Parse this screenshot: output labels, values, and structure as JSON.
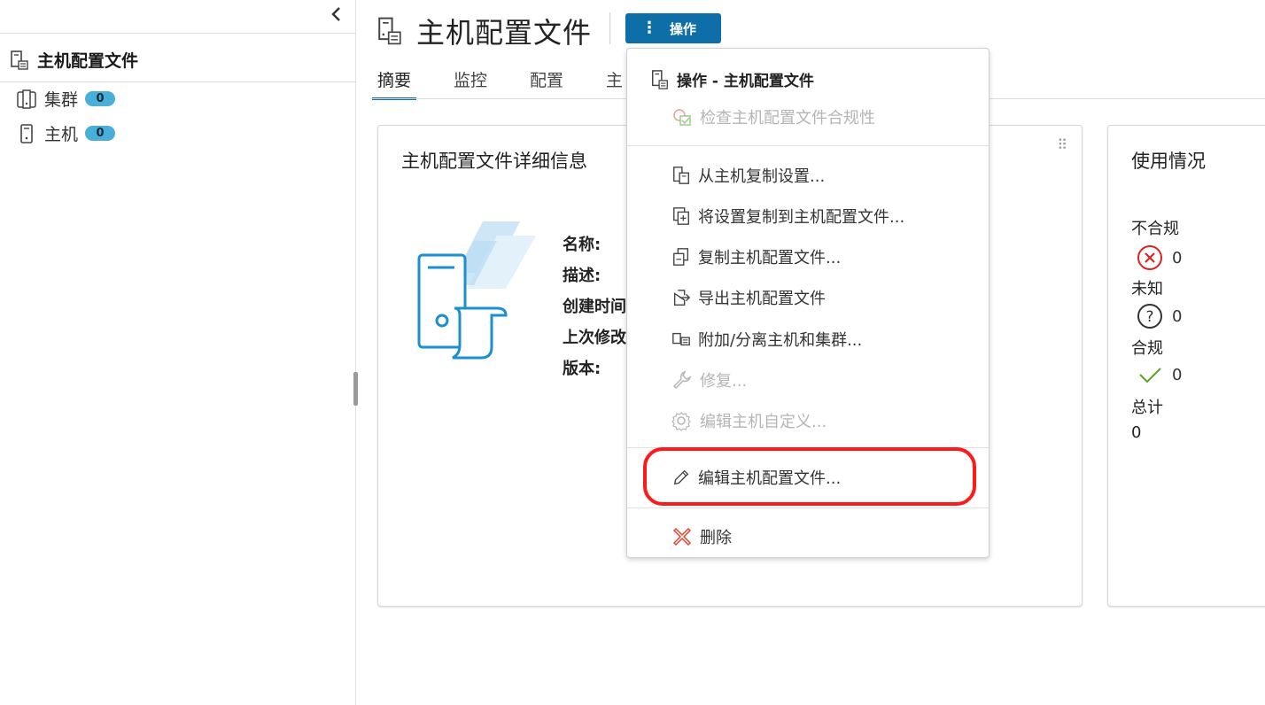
{
  "navigator": {
    "collapse_icon": "chevron-left",
    "root_label": "主机配置文件",
    "items": [
      {
        "label": "集群",
        "count": "0",
        "icon": "cluster-icon"
      },
      {
        "label": "主机",
        "count": "0",
        "icon": "host-icon"
      }
    ]
  },
  "header": {
    "title": "主机配置文件",
    "actions_label": "操作"
  },
  "tabs": [
    {
      "label": "摘要",
      "active": true
    },
    {
      "label": "监控",
      "active": false
    },
    {
      "label": "配置",
      "active": false
    },
    {
      "label": "主",
      "active": false
    }
  ],
  "details_card": {
    "title": "主机配置文件详细信息",
    "fields": [
      "名称:",
      "描述:",
      "创建时间",
      "上次修改",
      "版本:"
    ]
  },
  "usage_card": {
    "title": "使用情况",
    "rows": [
      {
        "label": "不合规",
        "value": "0",
        "icon": "error-circle-icon",
        "color": "#e02020"
      },
      {
        "label": "未知",
        "value": "0",
        "icon": "question-circle-icon",
        "color": "#333333"
      },
      {
        "label": "合规",
        "value": "0",
        "icon": "check-icon",
        "color": "#5aa220"
      },
      {
        "label": "总计",
        "value": "0"
      }
    ]
  },
  "actions_menu": {
    "header": "操作 - 主机配置文件",
    "items": [
      {
        "label": "检查主机配置文件合规性",
        "enabled": false,
        "icon": "check-compliance-icon"
      },
      {
        "label": "从主机复制设置...",
        "enabled": true,
        "icon": "copy-from-host-icon"
      },
      {
        "label": "将设置复制到主机配置文件...",
        "enabled": true,
        "icon": "copy-to-profile-icon"
      },
      {
        "label": "复制主机配置文件...",
        "enabled": true,
        "icon": "duplicate-icon"
      },
      {
        "label": "导出主机配置文件",
        "enabled": true,
        "icon": "export-icon"
      },
      {
        "label": "附加/分离主机和集群...",
        "enabled": true,
        "icon": "attach-icon"
      },
      {
        "label": "修复...",
        "enabled": false,
        "icon": "wrench-icon"
      },
      {
        "label": "编辑主机自定义...",
        "enabled": false,
        "icon": "gear-wrench-icon"
      },
      {
        "label": "编辑主机配置文件...",
        "enabled": true,
        "icon": "pencil-icon",
        "highlighted": true
      },
      {
        "label": "删除",
        "enabled": true,
        "icon": "delete-icon"
      }
    ]
  },
  "colors": {
    "accent": "#0e6fa8",
    "badge": "#49afd9",
    "highlight": "#ff1a1a",
    "delete": "#e0442e"
  }
}
